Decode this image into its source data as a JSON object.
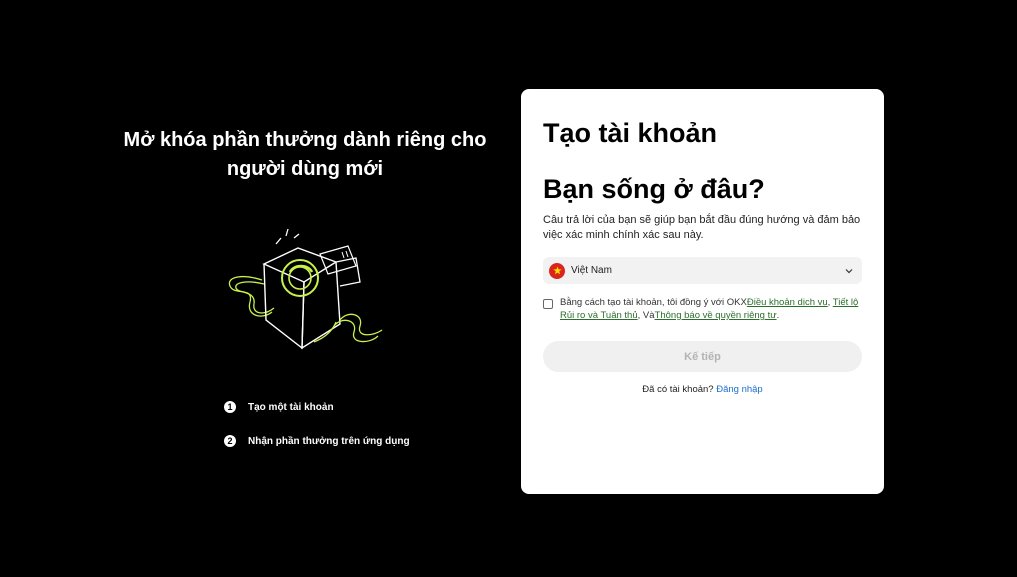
{
  "promo": {
    "title_line1": "Mở khóa phần thưởng dành riêng cho",
    "title_line2": "người dùng mới",
    "illustration_icon": "gift-box-ticket-illustration",
    "steps": [
      {
        "number": "1",
        "label": "Tạo một tài khoản"
      },
      {
        "number": "2",
        "label": "Nhận phần thưởng trên ứng dụng"
      }
    ]
  },
  "card": {
    "title": "Tạo tài khoản",
    "question": "Bạn sống ở đâu?",
    "description": "Câu trả lời của bạn sẽ giúp bạn bắt đầu đúng hướng và đảm bảo việc xác minh chính xác sau này.",
    "country": {
      "flag_icon": "vietnam-flag-icon",
      "selected": "Việt Nam"
    },
    "terms": {
      "prefix": "Bằng cách tạo tài khoản, tôi đồng ý với OKX",
      "link1": "Điều khoản dịch vụ",
      "sep1": ", ",
      "link2": "Tiết lộ Rủi ro và Tuân thủ",
      "sep2": ", Và",
      "link3": "Thông báo về quyền riêng tư",
      "suffix": "."
    },
    "next_button": "Kế tiếp",
    "login": {
      "prompt": "Đã có tài khoản? ",
      "link": "Đăng nhập"
    }
  },
  "colors": {
    "background": "#000000",
    "card": "#ffffff",
    "accent_green": "#c8f24a",
    "link_blue": "#1a6fd0",
    "flag_red": "#da251d"
  }
}
